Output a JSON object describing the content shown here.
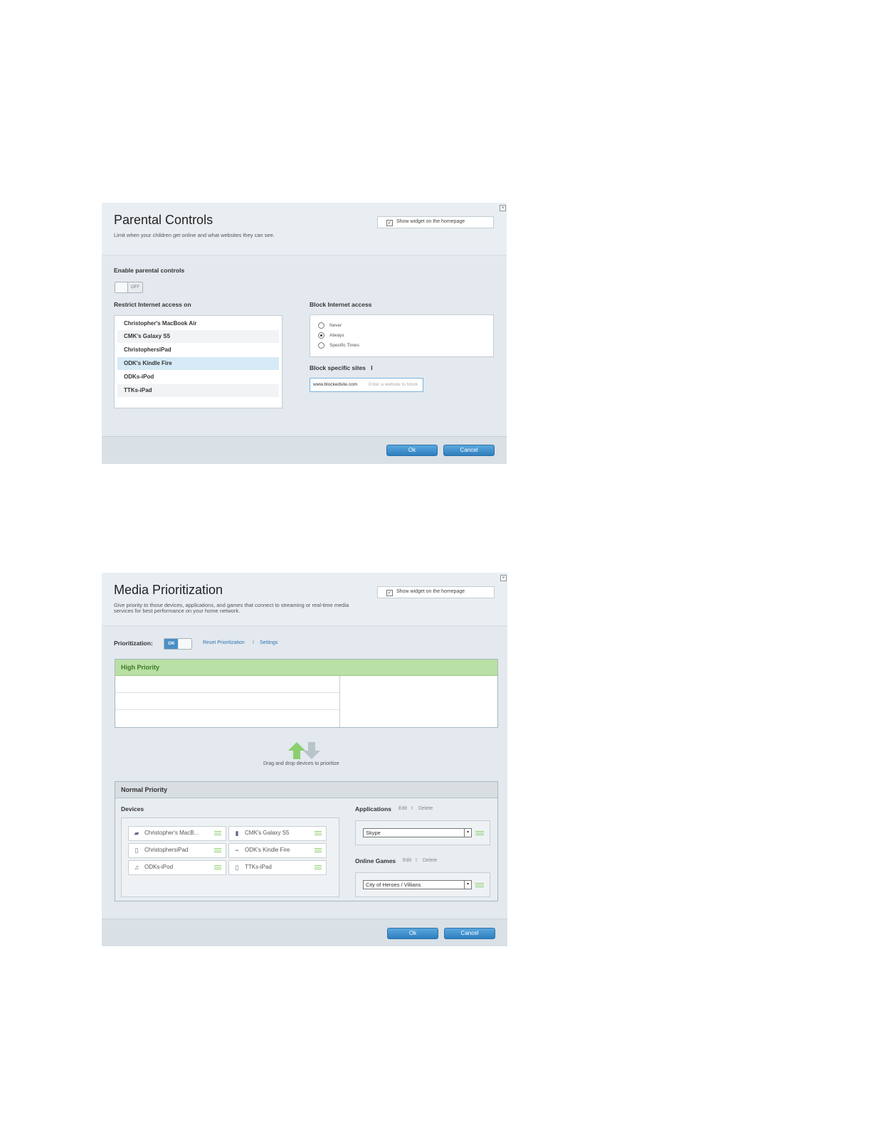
{
  "parental": {
    "title": "Parental Controls",
    "subtitle": "Limit when your children get online and what websites they can see.",
    "show_widget": "Show widget on the homepage",
    "enable_label": "Enable parental controls",
    "toggle_state": "OFF",
    "restrict_label": "Restrict Internet access on",
    "devices": [
      "Christopher's MacBook Air",
      "CMK's Galaxy S5",
      "ChristophersiPad",
      "ODK's Kindle Fire",
      "ODKs-iPod",
      "TTKs-iPad"
    ],
    "selected_device": "ODK's Kindle Fire",
    "block_label": "Block Internet access",
    "block_options": [
      "Never",
      "Always",
      "Specific Times"
    ],
    "block_selected": "Always",
    "sites_label": "Block specific sites",
    "sites_value": "www.blockedsite.com",
    "sites_placeholder": "Enter a website to block",
    "ok": "Ok",
    "cancel": "Cancel"
  },
  "media": {
    "title": "Media Prioritization",
    "subtitle_1": "Give priority to those devices, applications, and games that connect to streaming or real-time media",
    "subtitle_2": "services for best performance on your home network.",
    "show_widget": "Show widget on the homepage",
    "prioritization_label": "Prioritization:",
    "toggle_state": "ON",
    "reset_link": "Reset Prioritization",
    "separator": "I",
    "settings_link": "Settings",
    "high_priority": "High Priority",
    "drag_hint": "Drag and drop devices to prioritize",
    "normal_priority": "Normal Priority",
    "devices_label": "Devices",
    "devices": [
      {
        "name": "Christopher's MacB...",
        "icon": "laptop-icon"
      },
      {
        "name": "CMK's Galaxy S5",
        "icon": "phone-icon"
      },
      {
        "name": "ChristophersiPad",
        "icon": "tablet-icon"
      },
      {
        "name": "ODK's Kindle Fire",
        "icon": "kindle-icon"
      },
      {
        "name": "ODKs-iPod",
        "icon": "ipod-icon"
      },
      {
        "name": "TTKs-iPad",
        "icon": "tablet-icon"
      }
    ],
    "applications_label": "Applications",
    "edit": "Edit",
    "delete": "Delete",
    "application_value": "Skype",
    "online_games_label": "Online Games",
    "game_value": "City of Heroes / Villians",
    "ok": "Ok",
    "cancel": "Cancel"
  },
  "colors": {
    "high_priority_bar": "#b9e0a5",
    "button_blue": "#3d8fd0",
    "toggle_on": "#4a8fc6"
  }
}
